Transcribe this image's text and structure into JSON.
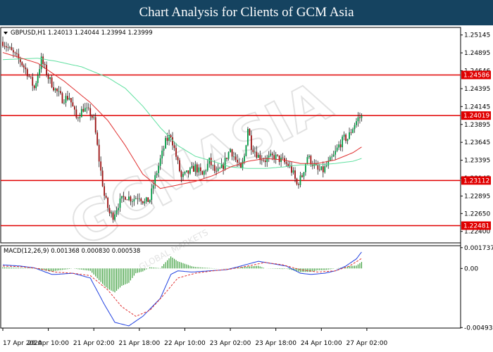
{
  "banner": {
    "title": "Chart Analysis for Clients of GCM Asia"
  },
  "colors": {
    "bull": "#009a44",
    "bear": "#9b1010",
    "ma_fast": "#e03030",
    "ma_slow": "#60e0a0",
    "level": "#e00000",
    "macd_line": "#2040e0",
    "signal_line": "#e03030",
    "hist": "#40a040",
    "banner_bg": "#154360"
  },
  "chart_data": [
    {
      "type": "candlestick",
      "symbol_header": "GBPUSD,H1  1.24013 1.24044 1.23994 1.23999",
      "ylim": [
        1.2224,
        1.2525
      ],
      "y_ticks": [
        "1.25145",
        "1.24895",
        "1.24646",
        "1.24395",
        "1.24145",
        "1.23895",
        "1.23645",
        "1.23395",
        "1.23145",
        "1.22895",
        "1.22650",
        "1.22400"
      ],
      "levels": [
        {
          "value": 1.24586,
          "label": "1.24586"
        },
        {
          "value": 1.24019,
          "label": "1.24019"
        },
        {
          "value": 1.23112,
          "label": "1.23112"
        },
        {
          "value": 1.22481,
          "label": "1.22481"
        }
      ],
      "anchors": [
        [
          0,
          1.2505
        ],
        [
          6,
          1.2488
        ],
        [
          10,
          1.2478
        ],
        [
          14,
          1.2462
        ],
        [
          18,
          1.244
        ],
        [
          22,
          1.248
        ],
        [
          26,
          1.2455
        ],
        [
          30,
          1.2438
        ],
        [
          34,
          1.2425
        ],
        [
          38,
          1.2428
        ],
        [
          42,
          1.2398
        ],
        [
          46,
          1.2412
        ],
        [
          50,
          1.2405
        ],
        [
          52,
          1.2395
        ],
        [
          55,
          1.234
        ],
        [
          58,
          1.229
        ],
        [
          61,
          1.2265
        ],
        [
          63,
          1.2262
        ],
        [
          66,
          1.2278
        ],
        [
          70,
          1.229
        ],
        [
          74,
          1.2285
        ],
        [
          78,
          1.229
        ],
        [
          81,
          1.228
        ],
        [
          84,
          1.2285
        ],
        [
          87,
          1.2315
        ],
        [
          90,
          1.234
        ],
        [
          93,
          1.2365
        ],
        [
          96,
          1.2375
        ],
        [
          99,
          1.2345
        ],
        [
          102,
          1.2315
        ],
        [
          106,
          1.2322
        ],
        [
          110,
          1.233
        ],
        [
          114,
          1.2318
        ],
        [
          118,
          1.2338
        ],
        [
          122,
          1.232
        ],
        [
          126,
          1.2332
        ],
        [
          128,
          1.2345
        ],
        [
          130,
          1.2355
        ],
        [
          133,
          1.234
        ],
        [
          136,
          1.2325
        ],
        [
          138,
          1.2345
        ],
        [
          140,
          1.2385
        ],
        [
          142,
          1.236
        ],
        [
          146,
          1.2345
        ],
        [
          150,
          1.234
        ],
        [
          155,
          1.2345
        ],
        [
          160,
          1.2338
        ],
        [
          164,
          1.233
        ],
        [
          166,
          1.232
        ],
        [
          168,
          1.2305
        ],
        [
          171,
          1.2318
        ],
        [
          174,
          1.2345
        ],
        [
          177,
          1.2335
        ],
        [
          180,
          1.2325
        ],
        [
          183,
          1.2325
        ],
        [
          186,
          1.2335
        ],
        [
          189,
          1.2345
        ],
        [
          192,
          1.236
        ],
        [
          195,
          1.237
        ],
        [
          197,
          1.237
        ],
        [
          199,
          1.238
        ],
        [
          201,
          1.239
        ],
        [
          203,
          1.2398
        ],
        [
          205,
          1.24
        ]
      ],
      "ma_fast": [
        [
          0,
          1.249
        ],
        [
          20,
          1.2475
        ],
        [
          35,
          1.245
        ],
        [
          50,
          1.242
        ],
        [
          60,
          1.2395
        ],
        [
          70,
          1.236
        ],
        [
          80,
          1.232
        ],
        [
          90,
          1.23
        ],
        [
          100,
          1.2305
        ],
        [
          110,
          1.231
        ],
        [
          120,
          1.2318
        ],
        [
          130,
          1.233
        ],
        [
          140,
          1.2338
        ],
        [
          150,
          1.2342
        ],
        [
          160,
          1.234
        ],
        [
          170,
          1.2335
        ],
        [
          180,
          1.2335
        ],
        [
          190,
          1.234
        ],
        [
          200,
          1.235
        ],
        [
          205,
          1.2358
        ]
      ],
      "ma_slow": [
        [
          0,
          1.248
        ],
        [
          20,
          1.2482
        ],
        [
          30,
          1.2478
        ],
        [
          45,
          1.247
        ],
        [
          60,
          1.2455
        ],
        [
          70,
          1.244
        ],
        [
          80,
          1.2415
        ],
        [
          90,
          1.2385
        ],
        [
          100,
          1.236
        ],
        [
          110,
          1.2345
        ],
        [
          120,
          1.2338
        ],
        [
          130,
          1.233
        ],
        [
          140,
          1.2328
        ],
        [
          150,
          1.2328
        ],
        [
          160,
          1.233
        ],
        [
          170,
          1.2333
        ],
        [
          180,
          1.2333
        ],
        [
          190,
          1.2335
        ],
        [
          200,
          1.2338
        ],
        [
          205,
          1.2342
        ]
      ]
    },
    {
      "type": "macd",
      "header": "MACD(12,26,9)  0.001368  0.000830  0.000538",
      "ylim": [
        -0.00498,
        0.0019
      ],
      "y_ticks": [
        {
          "value": 0.001737,
          "label": "0.001737"
        },
        {
          "value": 0.0,
          "label": "0.00"
        },
        {
          "value": -0.004939,
          "label": "-0.004939"
        }
      ],
      "macd": [
        [
          0,
          0.0003
        ],
        [
          10,
          0.0002
        ],
        [
          18,
          5e-05
        ],
        [
          28,
          -0.0005
        ],
        [
          30,
          -0.0005
        ],
        [
          40,
          -0.0004
        ],
        [
          50,
          -0.0008
        ],
        [
          58,
          -0.003
        ],
        [
          64,
          -0.0045
        ],
        [
          72,
          -0.0048
        ],
        [
          80,
          -0.004
        ],
        [
          90,
          -0.0025
        ],
        [
          96,
          -0.0005
        ],
        [
          100,
          -0.0002
        ],
        [
          108,
          -0.0003
        ],
        [
          118,
          -0.0002
        ],
        [
          128,
          -0.0001
        ],
        [
          136,
          0.0002
        ],
        [
          146,
          0.0006
        ],
        [
          154,
          0.0004
        ],
        [
          162,
          0.0002
        ],
        [
          170,
          -0.0004
        ],
        [
          176,
          -0.0005
        ],
        [
          184,
          -0.0004
        ],
        [
          190,
          -0.0002
        ],
        [
          196,
          0.0002
        ],
        [
          202,
          0.0008
        ],
        [
          205,
          0.00137
        ]
      ],
      "signal": [
        [
          0,
          0.0002
        ],
        [
          10,
          0.00015
        ],
        [
          20,
          0.0
        ],
        [
          30,
          -0.0003
        ],
        [
          40,
          -0.0004
        ],
        [
          50,
          -0.0006
        ],
        [
          60,
          -0.0018
        ],
        [
          68,
          -0.0032
        ],
        [
          76,
          -0.004
        ],
        [
          84,
          -0.0035
        ],
        [
          92,
          -0.0022
        ],
        [
          100,
          -0.0008
        ],
        [
          110,
          -0.0004
        ],
        [
          120,
          -0.0002
        ],
        [
          130,
          -5e-05
        ],
        [
          140,
          0.0002
        ],
        [
          150,
          0.0005
        ],
        [
          160,
          0.0003
        ],
        [
          170,
          -0.0001
        ],
        [
          180,
          -0.0003
        ],
        [
          190,
          -0.0002
        ],
        [
          198,
          0.0002
        ],
        [
          205,
          0.00083
        ]
      ]
    }
  ],
  "time_axis": [
    {
      "label": "17 Apr 2020",
      "bar": 0
    },
    {
      "label": "20 Apr 10:00",
      "bar": 26
    },
    {
      "label": "21 Apr 02:00",
      "bar": 52
    },
    {
      "label": "21 Apr 18:00",
      "bar": 78
    },
    {
      "label": "22 Apr 10:00",
      "bar": 104
    },
    {
      "label": "23 Apr 02:00",
      "bar": 130
    },
    {
      "label": "23 Apr 18:00",
      "bar": 156
    },
    {
      "label": "24 Apr 10:00",
      "bar": 182
    },
    {
      "label": "27 Apr 02:00",
      "bar": 208
    }
  ],
  "watermark": {
    "brand": "GCMASIA",
    "sub": "GLOBAL MARKETS"
  }
}
